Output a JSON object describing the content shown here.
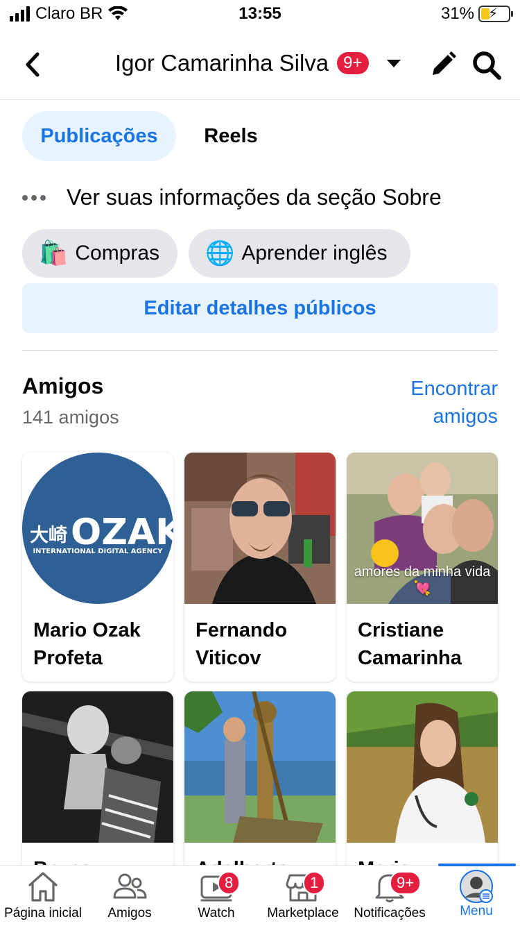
{
  "status_bar": {
    "carrier": "Claro BR",
    "time": "13:55",
    "battery": "31%",
    "battery_level": 0.31
  },
  "header": {
    "title": "Igor Camarinha Silva",
    "badge": "9+"
  },
  "tabs": [
    {
      "label": "Publicações",
      "active": true
    },
    {
      "label": "Reels",
      "active": false
    }
  ],
  "about": {
    "label": "Ver suas informações da seção Sobre"
  },
  "chips": [
    {
      "emoji": "🛍️",
      "label": "Compras"
    },
    {
      "emoji": "🌐",
      "label": "Aprender inglês"
    }
  ],
  "edit_public": {
    "label": "Editar detalhes públicos"
  },
  "friends": {
    "title": "Amigos",
    "count": "141 amigos",
    "find_link": "Encontrar amigos",
    "cards": [
      {
        "name": "Mario Ozak Profeta",
        "logo_glyph": "大崎",
        "logo_text": "OZAKI",
        "logo_subtext": "INTERNATIONAL DIGITAL AGENCY"
      },
      {
        "name": "Fernando Viticov"
      },
      {
        "name": "Cristiane Camarinha",
        "caption": "amores da minha vida 💘"
      },
      {
        "name": "Bruno"
      },
      {
        "name": "Adalberto"
      },
      {
        "name": "Maria"
      }
    ]
  },
  "tabbar": [
    {
      "label": "Página inicial",
      "badge": ""
    },
    {
      "label": "Amigos",
      "badge": ""
    },
    {
      "label": "Watch",
      "badge": "8"
    },
    {
      "label": "Marketplace",
      "badge": "1"
    },
    {
      "label": "Notificações",
      "badge": "9+"
    },
    {
      "label": "Menu",
      "badge": "",
      "active": true
    }
  ],
  "colors": {
    "accent": "#1b74e4",
    "accent_bg": "#e7f3ff",
    "badge": "#e41e3f",
    "chip_bg": "#e4e6eb",
    "secondary_text": "#65676b"
  }
}
